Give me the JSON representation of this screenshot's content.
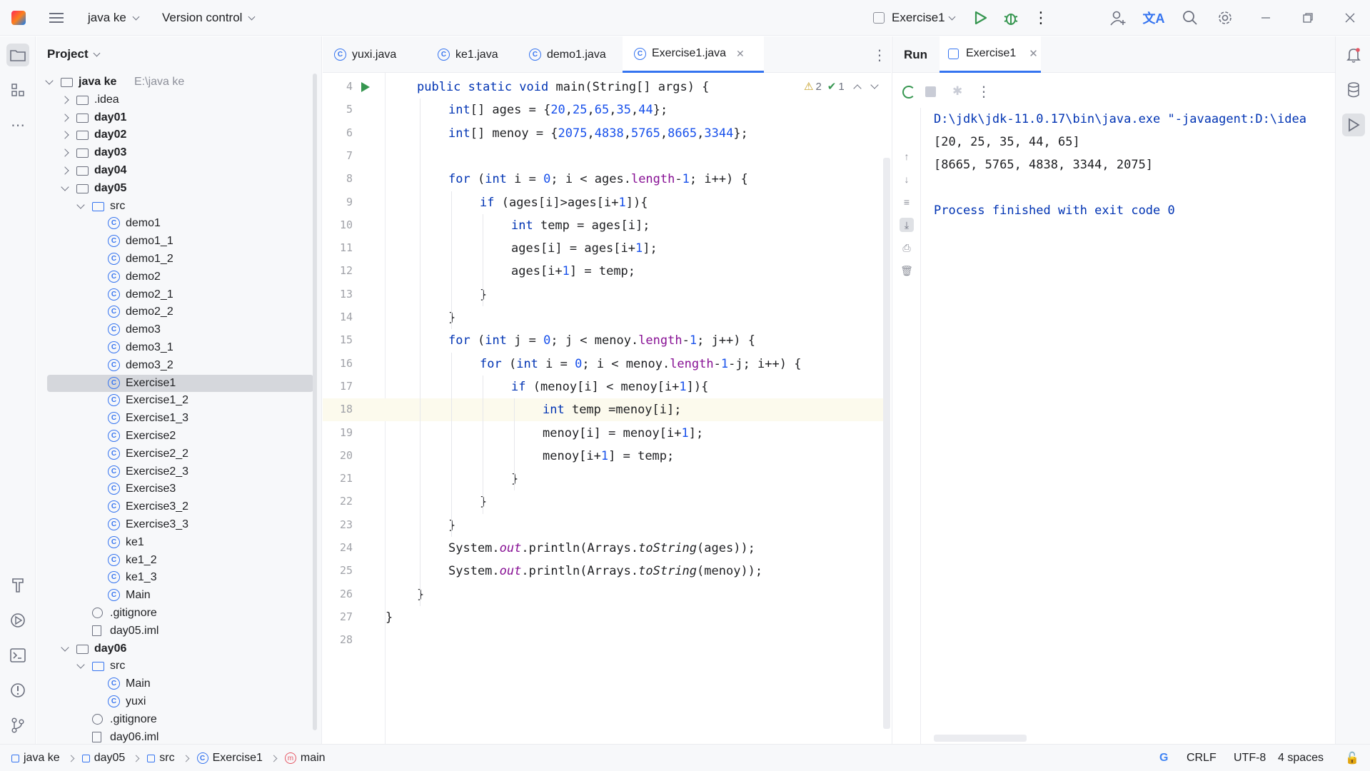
{
  "titlebar": {
    "project_name": "java ke",
    "vcs": "Version control",
    "run_config": "Exercise1"
  },
  "project": {
    "header": "Project",
    "root_name": "java ke",
    "root_path": "E:\\java ke",
    "tree": [
      {
        "label": "java ke",
        "depth": 0,
        "kind": "root",
        "open": true
      },
      {
        "label": ".idea",
        "depth": 1,
        "kind": "folder",
        "open": false
      },
      {
        "label": "day01",
        "depth": 1,
        "kind": "module",
        "open": false
      },
      {
        "label": "day02",
        "depth": 1,
        "kind": "module",
        "open": false
      },
      {
        "label": "day03",
        "depth": 1,
        "kind": "module",
        "open": false
      },
      {
        "label": "day04",
        "depth": 1,
        "kind": "module",
        "open": false
      },
      {
        "label": "day05",
        "depth": 1,
        "kind": "module",
        "open": true
      },
      {
        "label": "src",
        "depth": 2,
        "kind": "src",
        "open": true
      },
      {
        "label": "demo1",
        "depth": 3,
        "kind": "class"
      },
      {
        "label": "demo1_1",
        "depth": 3,
        "kind": "class"
      },
      {
        "label": "demo1_2",
        "depth": 3,
        "kind": "class"
      },
      {
        "label": "demo2",
        "depth": 3,
        "kind": "class"
      },
      {
        "label": "demo2_1",
        "depth": 3,
        "kind": "class"
      },
      {
        "label": "demo2_2",
        "depth": 3,
        "kind": "class"
      },
      {
        "label": "demo3",
        "depth": 3,
        "kind": "class"
      },
      {
        "label": "demo3_1",
        "depth": 3,
        "kind": "class"
      },
      {
        "label": "demo3_2",
        "depth": 3,
        "kind": "class"
      },
      {
        "label": "Exercise1",
        "depth": 3,
        "kind": "class",
        "selected": true
      },
      {
        "label": "Exercise1_2",
        "depth": 3,
        "kind": "class"
      },
      {
        "label": "Exercise1_3",
        "depth": 3,
        "kind": "class"
      },
      {
        "label": "Exercise2",
        "depth": 3,
        "kind": "class"
      },
      {
        "label": "Exercise2_2",
        "depth": 3,
        "kind": "class"
      },
      {
        "label": "Exercise2_3",
        "depth": 3,
        "kind": "class"
      },
      {
        "label": "Exercise3",
        "depth": 3,
        "kind": "class"
      },
      {
        "label": "Exercise3_2",
        "depth": 3,
        "kind": "class"
      },
      {
        "label": "Exercise3_3",
        "depth": 3,
        "kind": "class"
      },
      {
        "label": "ke1",
        "depth": 3,
        "kind": "class"
      },
      {
        "label": "ke1_2",
        "depth": 3,
        "kind": "class"
      },
      {
        "label": "ke1_3",
        "depth": 3,
        "kind": "class"
      },
      {
        "label": "Main",
        "depth": 3,
        "kind": "class"
      },
      {
        "label": ".gitignore",
        "depth": 2,
        "kind": "ignore"
      },
      {
        "label": "day05.iml",
        "depth": 2,
        "kind": "file"
      },
      {
        "label": "day06",
        "depth": 1,
        "kind": "module",
        "open": true
      },
      {
        "label": "src",
        "depth": 2,
        "kind": "src",
        "open": true
      },
      {
        "label": "Main",
        "depth": 3,
        "kind": "class"
      },
      {
        "label": "yuxi",
        "depth": 3,
        "kind": "class"
      },
      {
        "label": ".gitignore",
        "depth": 2,
        "kind": "ignore"
      },
      {
        "label": "day06.iml",
        "depth": 2,
        "kind": "file"
      }
    ]
  },
  "editor": {
    "tabs": [
      {
        "label": "yuxi.java",
        "active": false
      },
      {
        "label": "ke1.java",
        "active": false
      },
      {
        "label": "demo1.java",
        "active": false
      },
      {
        "label": "Exercise1.java",
        "active": true
      }
    ],
    "warnings": "2",
    "checks": "1",
    "current_line": 18,
    "lines": [
      {
        "n": "4",
        "html": "<span class=\"kw\">public static void</span> main(String[] args) {",
        "indent": 1
      },
      {
        "n": "5",
        "html": "<span class=\"kw\">int</span>[] ages = {<span class=\"num\">20</span>,<span class=\"num\">25</span>,<span class=\"num\">65</span>,<span class=\"num\">35</span>,<span class=\"num\">44</span>};",
        "indent": 2
      },
      {
        "n": "6",
        "html": "<span class=\"kw\">int</span>[] menoy = {<span class=\"num\">2075</span>,<span class=\"num\">4838</span>,<span class=\"num\">5765</span>,<span class=\"num\">8665</span>,<span class=\"num\">3344</span>};",
        "indent": 2
      },
      {
        "n": "7",
        "html": "",
        "indent": 0
      },
      {
        "n": "8",
        "html": "<span class=\"kw\">for</span> (<span class=\"kw\">int</span> i = <span class=\"num\">0</span>; i &lt; ages.<span class=\"fld\">length</span>-<span class=\"num\">1</span>; i++) {",
        "indent": 2
      },
      {
        "n": "9",
        "html": "<span class=\"kw\">if</span> (ages[i]&gt;ages[i+<span class=\"num\">1</span>]){",
        "indent": 3
      },
      {
        "n": "10",
        "html": "<span class=\"kw\">int</span> temp = ages[i];",
        "indent": 4
      },
      {
        "n": "11",
        "html": "ages[i] = ages[i+<span class=\"num\">1</span>];",
        "indent": 4
      },
      {
        "n": "12",
        "html": "ages[i+<span class=\"num\">1</span>] = temp;",
        "indent": 4
      },
      {
        "n": "13",
        "html": "}",
        "indent": 3
      },
      {
        "n": "14",
        "html": "}",
        "indent": 2
      },
      {
        "n": "15",
        "html": "<span class=\"kw\">for</span> (<span class=\"kw\">int</span> j = <span class=\"num\">0</span>; j &lt; menoy.<span class=\"fld\">length</span>-<span class=\"num\">1</span>; j++) {",
        "indent": 2
      },
      {
        "n": "16",
        "html": "<span class=\"kw\">for</span> (<span class=\"kw\">int</span> i = <span class=\"num\">0</span>; i &lt; menoy.<span class=\"fld\">length</span>-<span class=\"num\">1</span>-j; i++) {",
        "indent": 3
      },
      {
        "n": "17",
        "html": "<span class=\"kw\">if</span> (menoy[i] &lt; menoy[i+<span class=\"num\">1</span>]){",
        "indent": 4
      },
      {
        "n": "18",
        "html": "<span class=\"kw\">int</span> temp =menoy[i];",
        "indent": 5
      },
      {
        "n": "19",
        "html": "menoy[i] = menoy[i+<span class=\"num\">1</span>];",
        "indent": 5
      },
      {
        "n": "20",
        "html": "menoy[i+<span class=\"num\">1</span>] = temp;",
        "indent": 5
      },
      {
        "n": "21",
        "html": "}",
        "indent": 4
      },
      {
        "n": "22",
        "html": "}",
        "indent": 3
      },
      {
        "n": "23",
        "html": "}",
        "indent": 2
      },
      {
        "n": "24",
        "html": "System.<span class=\"fld ital\">out</span>.println(Arrays.<span class=\"ital\">toString</span>(ages));",
        "indent": 2
      },
      {
        "n": "25",
        "html": "System.<span class=\"fld ital\">out</span>.println(Arrays.<span class=\"ital\">toString</span>(menoy));",
        "indent": 2
      },
      {
        "n": "26",
        "html": "}",
        "indent": 1
      },
      {
        "n": "27",
        "html": "}",
        "indent": 0
      },
      {
        "n": "28",
        "html": "",
        "indent": 0
      }
    ]
  },
  "run": {
    "title": "Run",
    "tab": "Exercise1",
    "console": [
      {
        "text": "D:\\jdk\\jdk-11.0.17\\bin\\java.exe \"-javaagent:D:\\idea",
        "color": "#0033b3"
      },
      {
        "text": "[20, 25, 35, 44, 65]",
        "color": "#1e1f22"
      },
      {
        "text": "[8665, 5765, 4838, 3344, 2075]",
        "color": "#1e1f22"
      },
      {
        "text": "",
        "color": "#1e1f22"
      },
      {
        "text": "Process finished with exit code 0",
        "color": "#0033b3"
      }
    ]
  },
  "status": {
    "breadcrumb": [
      "java ke",
      "day05",
      "src",
      "Exercise1",
      "main"
    ],
    "line_sep": "CRLF",
    "encoding": "UTF-8",
    "indent": "4 spaces"
  },
  "colors": {
    "accent": "#3574f0",
    "run_green": "#369650",
    "keyword": "#0033b3",
    "number": "#1750eb",
    "field": "#871094"
  }
}
